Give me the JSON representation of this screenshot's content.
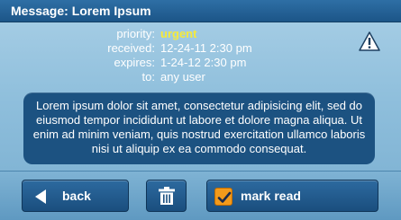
{
  "title": "Message: Lorem Ipsum",
  "meta": {
    "priority_label": "priority:",
    "priority_value": "urgent",
    "received_label": "received:",
    "received_value": "12-24-11 2:30 pm",
    "expires_label": "expires:",
    "expires_value": "1-24-12 2:30 pm",
    "to_label": "to:",
    "to_value": "any user"
  },
  "message_body": "Lorem ipsum dolor sit amet, consectetur adipisicing elit, sed do eiusmod tempor incididunt ut labore et dolore magna aliqua. Ut enim ad minim veniam, quis nostrud exercitation ullamco laboris nisi ut aliquip ex ea commodo consequat.",
  "toolbar": {
    "back_label": "back",
    "trash_icon": "trash-icon",
    "mark_read_label": "mark read",
    "mark_read_checked": true
  },
  "icons": {
    "warning": "warning-icon"
  },
  "colors": {
    "urgent": "#f6ea3a",
    "panel_dark": "#1c5281",
    "check_orange": "#f39a1b"
  }
}
